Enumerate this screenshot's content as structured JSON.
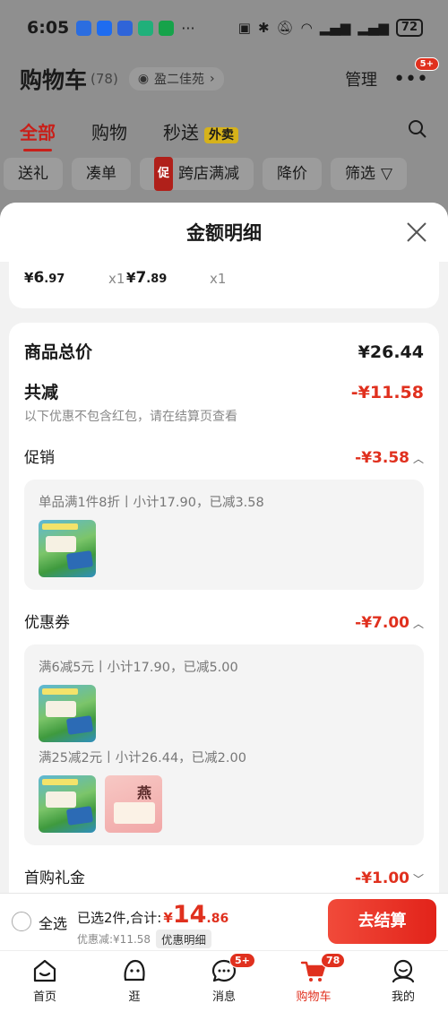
{
  "status_bar": {
    "time": "6:05",
    "dots": "···",
    "battery": "72",
    "app_icons": [
      "app-icon-blue",
      "app-icon-location",
      "app-icon-tencent",
      "app-icon-boss",
      "app-icon-green"
    ],
    "colors": {
      "bg": "#8f8f8f"
    }
  },
  "cart_header": {
    "title": "购物车",
    "count": "(78)",
    "address": "盈二佳苑",
    "manage": "管理",
    "more_badge": "5+"
  },
  "tabs": {
    "all": "全部",
    "shopping": "购物",
    "instant": "秒送",
    "takeout": "外卖"
  },
  "filter_chips": {
    "gift": "送礼",
    "combine": "凑单",
    "promo_tag": "促",
    "cross_store": "跨店满减",
    "price_drop": "降价",
    "filter": "筛选"
  },
  "sheet": {
    "title": "金额明细",
    "products": [
      {
        "yen": "¥",
        "int": "6",
        "dec": ".97",
        "qty": "x1"
      },
      {
        "yen": "¥",
        "int": "7",
        "dec": ".89",
        "qty": "x1"
      }
    ],
    "total_label": "商品总价",
    "total_value": "¥26.44",
    "reduce_label": "共减",
    "reduce_value": "-¥11.58",
    "reduce_note": "以下优惠不包含红包，请在结算页查看",
    "promo": {
      "label": "促销",
      "value": "-¥3.58",
      "rule": "单品满1件8折丨小计17.90，已减3.58"
    },
    "coupon": {
      "label": "优惠券",
      "value": "-¥7.00",
      "rule1": "满6减5元丨小计17.90，已减5.00",
      "rule2": "满25减2元丨小计26.44，已减2.00"
    },
    "first_gift": {
      "label": "首购礼金",
      "value": "-¥1.00"
    },
    "thumb_b_text": "燕窝"
  },
  "checkout": {
    "select_all": "全选",
    "selected_text": "已选2件,合计:",
    "currency": "¥",
    "amount_int": "14",
    "amount_dec": ".86",
    "discount_text": "优惠减:¥11.58",
    "detail_button": "优惠明细",
    "pay_button": "去结算",
    "colors": {
      "accent": "#e0301e"
    }
  },
  "bottom_nav": {
    "home": "首页",
    "browse": "逛",
    "messages": "消息",
    "messages_badge": "5+",
    "cart": "购物车",
    "cart_badge": "78",
    "mine": "我的"
  }
}
